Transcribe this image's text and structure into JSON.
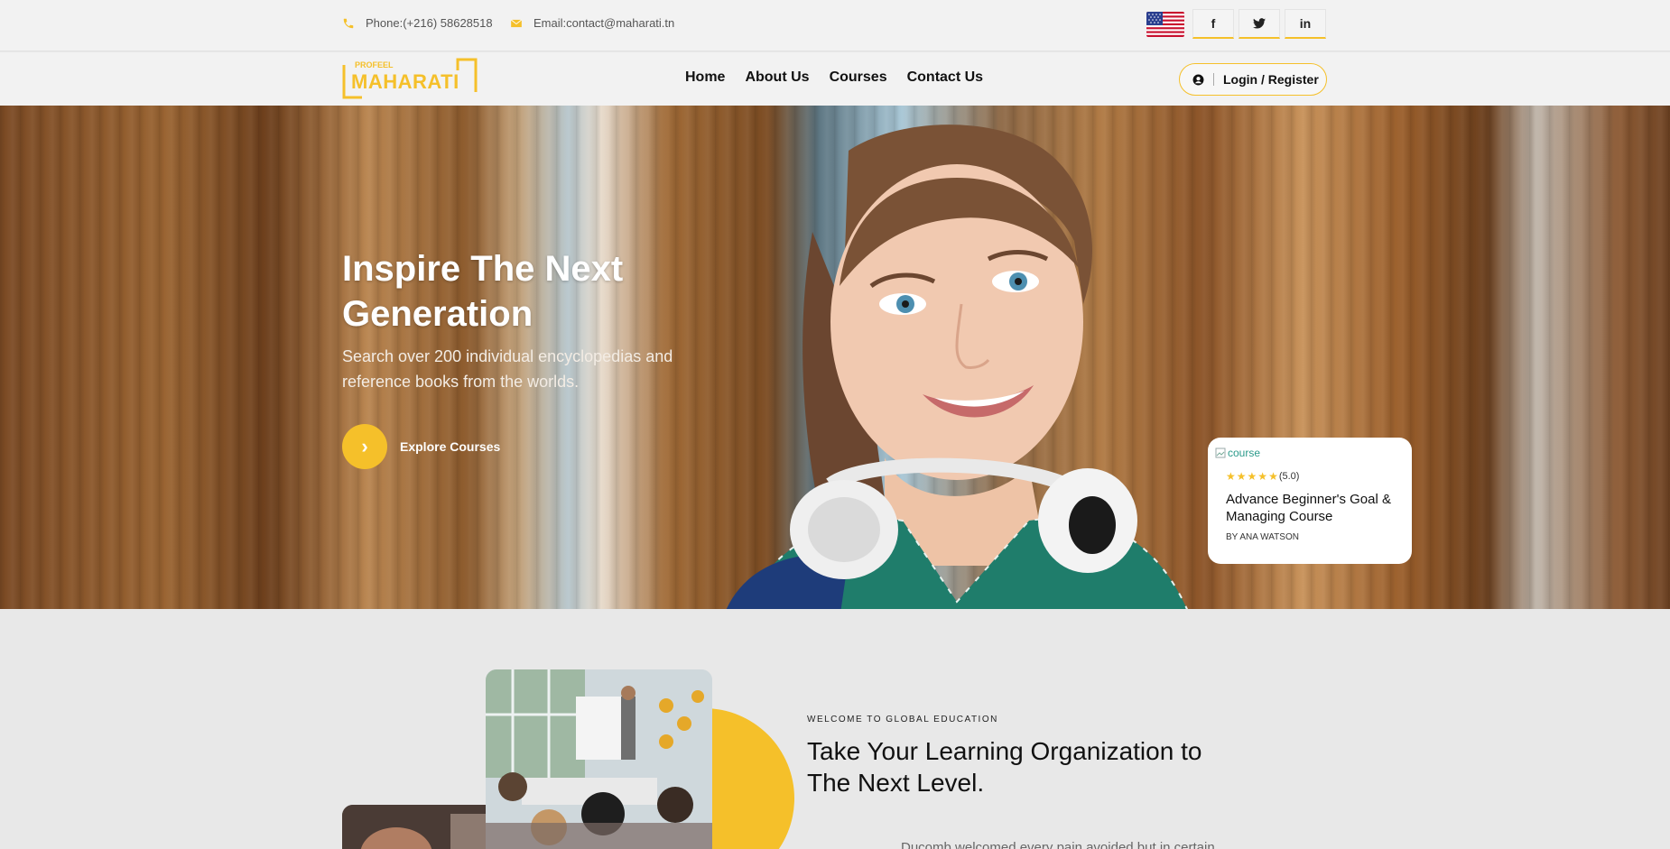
{
  "topbar": {
    "phone": "Phone:(+216) 58628518",
    "email": "Email:contact@maharati.tn",
    "social": [
      "f",
      "t",
      "in"
    ]
  },
  "logo": {
    "small_text": "PROFEEL",
    "main_text": "MAHARATI"
  },
  "nav": {
    "items": [
      "Home",
      "About Us",
      "Courses",
      "Contact Us"
    ],
    "login_label": "Login / Register"
  },
  "hero": {
    "title": "Inspire The Next Generation",
    "subtitle": "Search over 200 individual encyclopedias and reference books from the worlds.",
    "cta_label": "Explore Courses"
  },
  "course_card": {
    "image_alt": "course",
    "rating_text": "(5.0)",
    "stars": 5,
    "title": "Advance Beginner's Goal & Managing Course",
    "author": "BY ANA WATSON"
  },
  "about": {
    "eyebrow": "WELCOME TO GLOBAL EDUCATION",
    "title": "Take Your Learning Organization to The Next Level.",
    "text": "Ducomb welcomed every pain avoided but in certain"
  },
  "colors": {
    "accent": "#f5c02a",
    "background": "#e8e8e8",
    "text": "#111111"
  },
  "icons": {
    "phone": "phone-icon",
    "email": "envelope-icon",
    "user": "user-circle-icon",
    "arrow": "chevron-right-icon"
  }
}
